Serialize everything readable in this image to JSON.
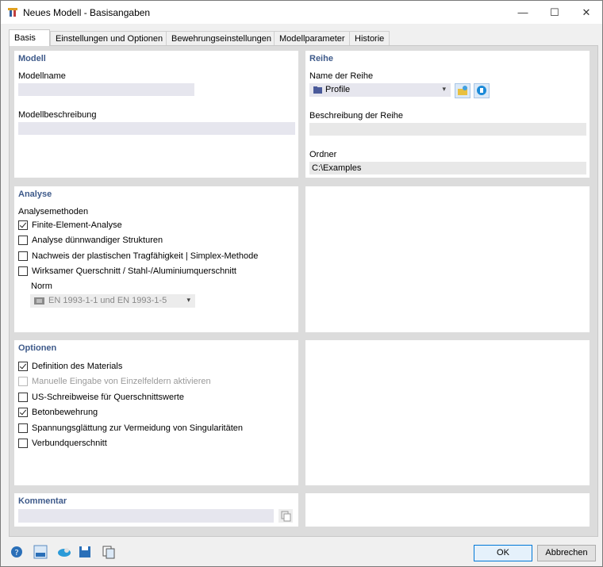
{
  "window": {
    "title": "Neues Modell - Basisangaben",
    "minimize": "—",
    "maximize": "☐",
    "close": "✕"
  },
  "tabs": [
    {
      "label": "Basis"
    },
    {
      "label": "Einstellungen und Optionen"
    },
    {
      "label": "Bewehrungseinstellungen"
    },
    {
      "label": "Modellparameter"
    },
    {
      "label": "Historie"
    }
  ],
  "modell": {
    "title": "Modell",
    "name_label": "Modellname",
    "name_value": "",
    "desc_label": "Modellbeschreibung",
    "desc_value": ""
  },
  "reihe": {
    "title": "Reihe",
    "name_label": "Name der Reihe",
    "name_value": "Profile",
    "desc_label": "Beschreibung der Reihe",
    "desc_value": "",
    "folder_label": "Ordner",
    "folder_value": "C:\\Examples"
  },
  "analyse": {
    "title": "Analyse",
    "methods_label": "Analysemethoden",
    "items": [
      {
        "label": "Finite-Element-Analyse",
        "checked": true
      },
      {
        "label": "Analyse dünnwandiger Strukturen",
        "checked": false
      },
      {
        "label": "Nachweis der plastischen Tragfähigkeit | Simplex-Methode",
        "checked": false
      },
      {
        "label": "Wirksamer Querschnitt / Stahl-/Aluminiumquerschnitt",
        "checked": false
      }
    ],
    "norm_label": "Norm",
    "norm_value": "EN 1993-1-1 und EN 1993-1-5"
  },
  "optionen": {
    "title": "Optionen",
    "items": [
      {
        "label": "Definition des Materials",
        "checked": true,
        "disabled": false
      },
      {
        "label": "Manuelle Eingabe von Einzelfeldern aktivieren",
        "checked": false,
        "disabled": true
      },
      {
        "label": "US-Schreibweise für Querschnittswerte",
        "checked": false,
        "disabled": false
      },
      {
        "label": "Betonbewehrung",
        "checked": true,
        "disabled": false
      },
      {
        "label": "Spannungsglättung zur Vermeidung von Singularitäten",
        "checked": false,
        "disabled": false
      },
      {
        "label": "Verbundquerschnitt",
        "checked": false,
        "disabled": false
      }
    ]
  },
  "kommentar": {
    "title": "Kommentar",
    "value": ""
  },
  "buttons": {
    "ok": "OK",
    "cancel": "Abbrechen"
  },
  "icons": [
    "help-icon",
    "units-icon",
    "recalc-icon",
    "save-icon",
    "copy-icon"
  ],
  "colors": {
    "accent": "#0078d7",
    "section_title": "#3e5a8a"
  }
}
